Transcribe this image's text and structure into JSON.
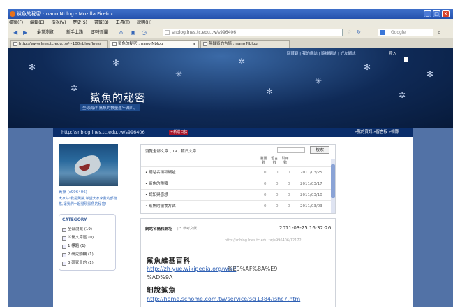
{
  "window": {
    "title": "鯊魚的秘密 : nano Nblog - Mozilla Firefox",
    "min": "_",
    "max": "□",
    "close": "X"
  },
  "menu": [
    "檔案(F)",
    "編輯(E)",
    "檢視(V)",
    "歷史(S)",
    "書籤(B)",
    "工具(T)",
    "說明(H)"
  ],
  "nav": {
    "back": "◀",
    "forward": "▶",
    "bookmarks": [
      "最常瀏覽",
      "新手上路",
      "即時新聞"
    ],
    "url": "snblog.lnes.tc.edu.tw/s996406",
    "search_placeholder": "Google"
  },
  "tabs": [
    {
      "label": "http://www.lnes.tc.edu.tw/~100nblog/lnes/"
    },
    {
      "label": "鯊魚的秘密 : nano Nblog"
    },
    {
      "label": "無敵鯊的告情 : nano Nblog"
    }
  ],
  "header": {
    "toplinks": "回首頁 | 我的網誌 | 隨機網誌 | 好友網誌",
    "login": "登入",
    "blog_title": "鯊魚的秘密",
    "blog_subtitle": "全球海洋 鯊魚的數量逐年減少。",
    "url_text": "http://snblog.lnes.tc.edu.tw/s996406",
    "new_post": "+新增日誌",
    "strip_links": "»我的資訊 »留言板 »相簿"
  },
  "sidebar": {
    "name": "黃鯊 (s996406)",
    "desc": "大家好!我是黃鯊,希望大家來我的部落格,讓我們一起發現鯊魚的秘密!",
    "category_title": "CATEGORY",
    "categories": [
      "全部瀏覽 (19)",
      "公開文章區 (0)",
      "1.標題 (1)",
      "2.研究動機 (1)",
      "3.研究目的 (1)"
    ]
  },
  "list": {
    "header": "瀏覽全部文章 ( 19 ) 篇日文章",
    "search_button": "搜索",
    "col_views": "瀏覽數",
    "col_comments": "留言數",
    "col_trackbacks": "引用數",
    "rows": [
      {
        "title": "網站名稱和網址",
        "v": "0",
        "c": "0",
        "t": "0",
        "date": "2011/03/25"
      },
      {
        "title": "鯊魚的種類",
        "v": "0",
        "c": "0",
        "t": "0",
        "date": "2011/03/17"
      },
      {
        "title": "認知與感想",
        "v": "0",
        "c": "0",
        "t": "0",
        "date": "2011/03/10"
      },
      {
        "title": "鯊魚的獵食方式",
        "v": "0",
        "c": "0",
        "t": "0",
        "date": "2011/03/03"
      }
    ]
  },
  "article": {
    "title": "網站名稱和網址",
    "category": "| 5.參考文獻",
    "date": "2011-03-25 16:32:26",
    "permalink": "http://snblog.lnes.tc.edu.tw/s996406/12172",
    "heading1": "鯊魚維基百科",
    "url1_link": "http://zh-yue.wikipedia.org/wiki/",
    "url1_rest": "%E9%AF%8A%E9",
    "url1_tail": "%AD%9A",
    "heading2": "細說鯊魚",
    "url2": "http://home.schome.com.tw/service/sci1384/ishc7.htm"
  }
}
